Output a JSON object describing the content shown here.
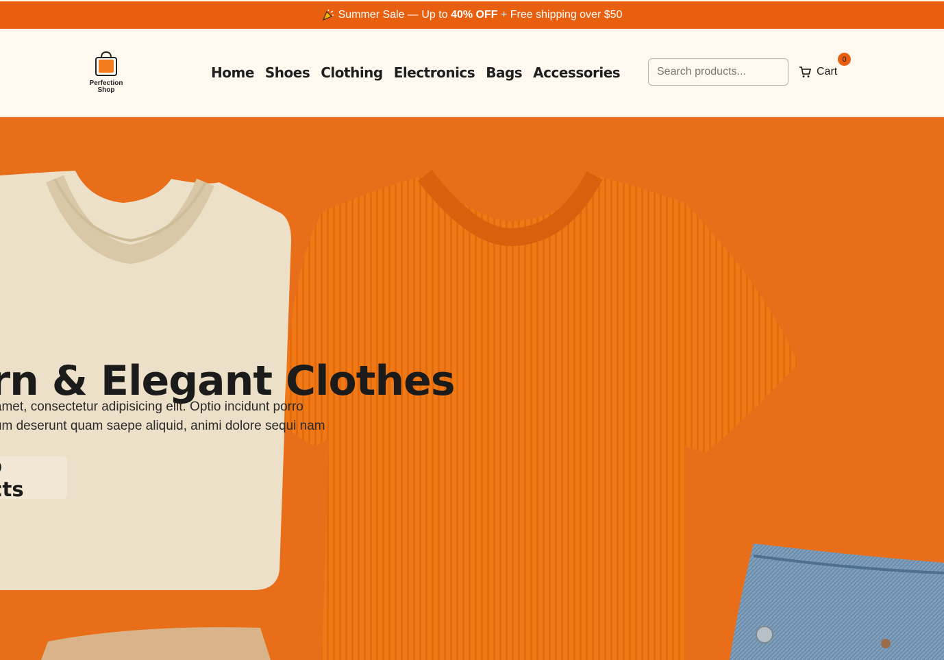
{
  "promo": {
    "icon": "party-popper-icon",
    "text_before": "Summer Sale — Up to ",
    "highlight": "40% OFF",
    "text_after": " + Free shipping over $50"
  },
  "header": {
    "logo_text": "Perfection Shop",
    "nav": [
      "Home",
      "Shoes",
      "Clothing",
      "Electronics",
      "Bags",
      "Accessories"
    ],
    "search_placeholder": "Search products...",
    "cart_label": "Cart",
    "cart_count": "0"
  },
  "hero": {
    "title": "Modern & Elegant Clothes",
    "description": "Lorem ipsum dolor sit amet, consectetur adipisicing elit. Optio incidunt porro commodi ab praesentium deserunt quam saepe aliquid, animi dolore sequi nam vero at!",
    "button_label": "Shop Products"
  },
  "colors": {
    "accent": "#e8600f",
    "header_bg": "#fff8ef",
    "hero_bg": "#e96e1a"
  }
}
